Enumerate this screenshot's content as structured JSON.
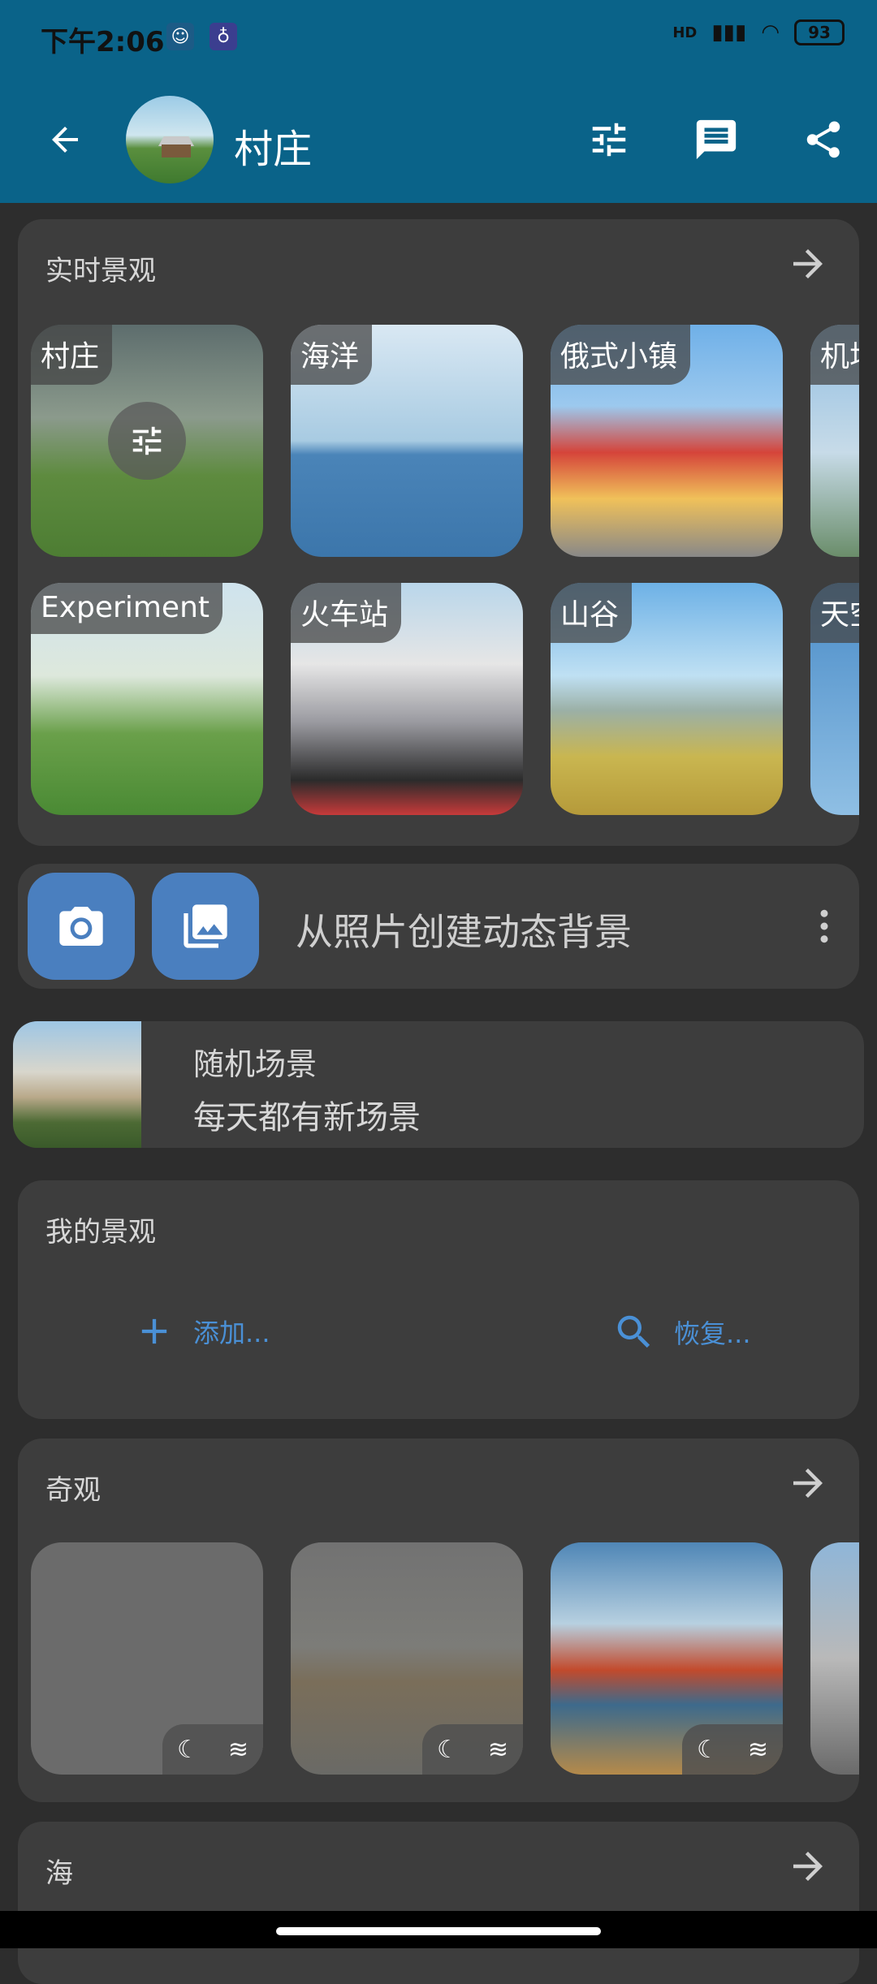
{
  "statusbar": {
    "time": "下午2:06",
    "battery": "93",
    "network": "HD"
  },
  "appbar": {
    "title": "村庄"
  },
  "sections": {
    "live": {
      "title": "实时景观"
    },
    "wonders": {
      "title": "奇观"
    },
    "sea": {
      "title": "海"
    },
    "mine": {
      "title": "我的景观",
      "add": "添加...",
      "restore": "恢复..."
    }
  },
  "live_tiles": [
    {
      "label": "村庄"
    },
    {
      "label": "海洋"
    },
    {
      "label": "俄式小镇"
    },
    {
      "label": "机场"
    },
    {
      "label": "Experiment"
    },
    {
      "label": "火车站"
    },
    {
      "label": "山谷"
    },
    {
      "label": "天空"
    }
  ],
  "photo_create": {
    "label": "从照片创建动态背景"
  },
  "random_scene": {
    "title": "随机场景",
    "subtitle": "每天都有新场景"
  },
  "colors": {
    "accent": "#4a7fbf",
    "appbar": "#0a6389",
    "link": "#4a90d6"
  }
}
